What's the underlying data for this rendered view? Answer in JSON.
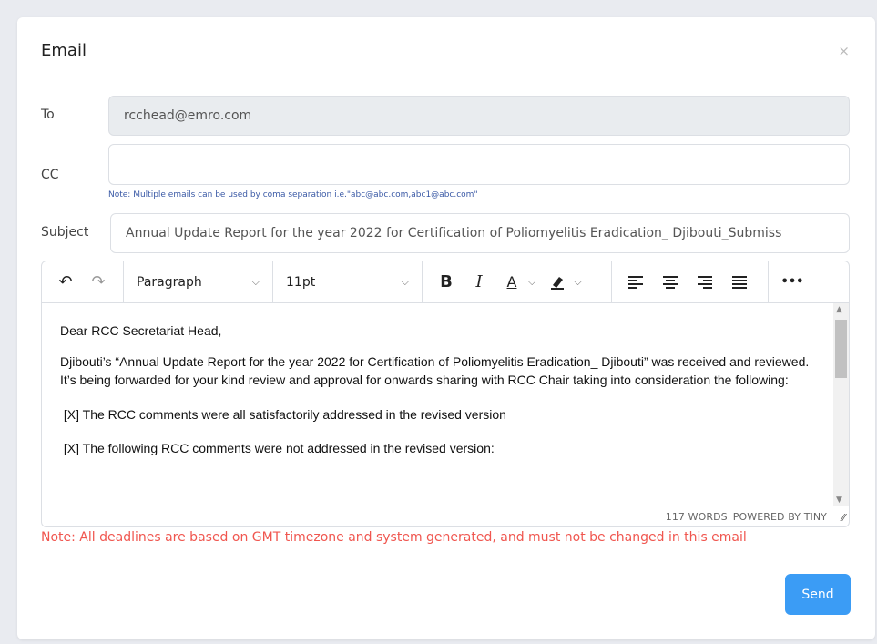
{
  "modal": {
    "title": "Email",
    "close_label": "×"
  },
  "form": {
    "to": {
      "label": "To",
      "value": "rcchead@emro.com"
    },
    "cc": {
      "label": "CC",
      "value": "",
      "note": "Note: Multiple emails can be used by coma separation i.e.\"abc@abc.com,abc1@abc.com\""
    },
    "subject": {
      "label": "Subject",
      "value": "Annual Update Report for the year 2022 for Certification of Poliomyelitis Eradication_ Djibouti_Submiss"
    }
  },
  "toolbar": {
    "undo_icon": "↶",
    "redo_icon": "↷",
    "block_format": "Paragraph",
    "font_size": "11pt",
    "bold": "B",
    "italic": "I",
    "text_color": "A",
    "highlight": "🖍",
    "more": "•••"
  },
  "editor": {
    "paragraphs": [
      "Dear RCC Secretariat Head,",
      "Djibouti’s “Annual Update Report for the year 2022 for Certification of Poliomyelitis Eradication_ Djibouti” was received and reviewed. It’s being forwarded for your kind review and approval for onwards sharing with RCC Chair taking into consideration the following:",
      " [X] The RCC comments were all satisfactorily addressed in the revised version",
      " [X] The following RCC comments were not addressed in the revised version:"
    ],
    "word_count": "117 WORDS",
    "powered_by": "POWERED BY TINY"
  },
  "deadline_note": "Note: All deadlines are based on GMT timezone and system generated, and must not be changed in this email",
  "send_label": "Send",
  "colors": {
    "accent": "#3b9cf5",
    "warning": "#f0564f",
    "note_blue": "#3b5aa6"
  }
}
